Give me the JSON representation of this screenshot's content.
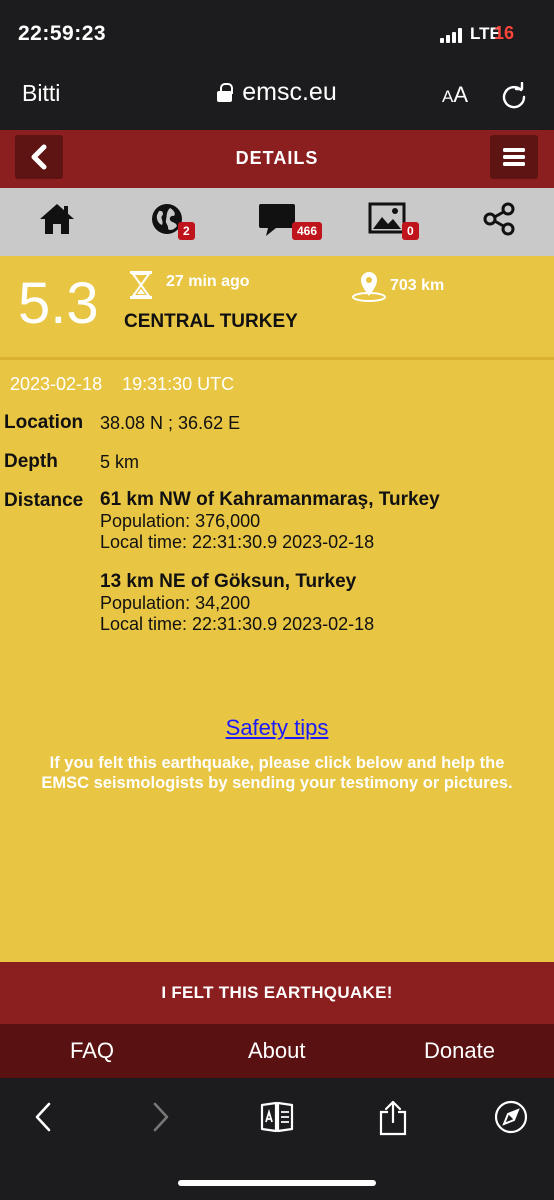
{
  "status_bar": {
    "time": "22:59:23",
    "network": "LTE",
    "battery": "16"
  },
  "browser": {
    "done_label": "Bitti",
    "url": "emsc.eu",
    "text_size_big": "A",
    "text_size_small": "A"
  },
  "header": {
    "title": "DETAILS"
  },
  "icon_nav": {
    "globe_count": "2",
    "comments_count": "466",
    "pictures_count": "0"
  },
  "event": {
    "magnitude": "5.3",
    "time_ago": "27 min ago",
    "distance_from_user": "703 km",
    "region": "CENTRAL TURKEY",
    "date": "2023-02-18",
    "time_utc": "19:31:30 UTC",
    "location_label": "Location",
    "location_value": "38.08 N ; 36.62 E",
    "depth_label": "Depth",
    "depth_value": "5 km",
    "distance_label": "Distance",
    "nearby": [
      {
        "place": "61 km NW of Kahramanmaraş, Turkey",
        "population": "Population: 376,000",
        "local_time": "Local time: 22:31:30.9 2023-02-18"
      },
      {
        "place": "13 km NE of Göksun, Turkey",
        "population": "Population: 34,200",
        "local_time": "Local time: 22:31:30.9 2023-02-18"
      }
    ]
  },
  "safety_tips": "Safety tips",
  "felt_note_line1": "If you felt this earthquake, please click below and help the",
  "felt_note_line2": "EMSC seismologists by sending your testimony or pictures.",
  "felt_button": "I FELT THIS EARTHQUAKE!",
  "footer": {
    "faq": "FAQ",
    "about": "About",
    "donate": "Donate"
  },
  "colors": {
    "header_red": "#8b1e1e",
    "content_yellow": "#e8c543",
    "badge_red": "#c0141c",
    "footer_dark": "#5a1111"
  }
}
